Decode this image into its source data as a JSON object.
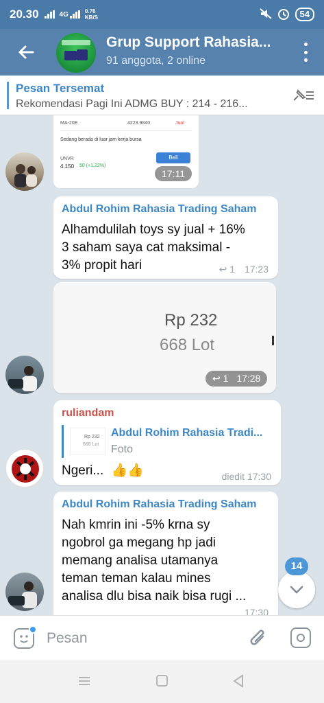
{
  "status_bar": {
    "time": "20.30",
    "network": "4G",
    "speed_value": "0.76",
    "speed_unit": "KB/S",
    "battery": "54"
  },
  "header": {
    "title": "Grup Support Rahasia...",
    "subtitle": "91 anggota, 2 online"
  },
  "pinned": {
    "title": "Pesan Tersemat",
    "text": "Rekomendasi Pagi Ini  ADMG BUY : 214 - 216..."
  },
  "messages": {
    "screenshot_msg": {
      "row_label": "MA-20E",
      "row_value": "4223.9840",
      "row_action": "Jual",
      "notice": "Sedang berada di luar jam kerja bursa",
      "ticker": "UNVR",
      "price": "4.150",
      "change": "50 (+1,22%)",
      "buy_label": "Beli",
      "time": "17:11"
    },
    "msg1": {
      "sender": "Abdul Rohim Rahasia Trading Saham",
      "line1": "Alhamdulilah toys sy jual + 16%",
      "line2": "3 saham saya cat maksimal -",
      "line3": "3% propit hari",
      "reply_count": "1",
      "time": "17:23"
    },
    "photo_msg": {
      "price": "Rp 232",
      "lot": "668 Lot",
      "reply_count": "1",
      "time": "17:28"
    },
    "msg2": {
      "sender": "ruliandam",
      "quote_sender": "Abdul Rohim Rahasia Tradi...",
      "quote_thumb_price": "Rp 232",
      "quote_thumb_lot": "668 Lot",
      "quote_text": "Foto",
      "text": "Ngeri...",
      "emoji": "👍👍",
      "time": "diedit 17:30"
    },
    "msg3": {
      "sender": "Abdul Rohim Rahasia Trading Saham",
      "line1": "Nah kmrin ini -5% krna sy",
      "line2": "ngobrol ga megang hp jadi",
      "line3": "memang analisa utamanya",
      "line4": "teman teman kalau mines",
      "line5": "analisa dlu bisa naik bisa rugi ...",
      "time": "17:30"
    }
  },
  "scroll_badge": "14",
  "input": {
    "placeholder": "Pesan"
  },
  "icons": [
    "back-arrow-icon",
    "more-vert-icon",
    "pin-list-icon",
    "reply-icon",
    "sticker-icon",
    "attach-icon",
    "camera-icon",
    "chevron-down-icon",
    "nav-menu-icon",
    "nav-home-icon",
    "nav-back-icon"
  ],
  "colors": {
    "header": "#5682ad",
    "statusbar": "#4a7aa7",
    "accent": "#3d87c4",
    "sender_alt": "#c8534a",
    "chat_bg": "#dbe3ea"
  }
}
